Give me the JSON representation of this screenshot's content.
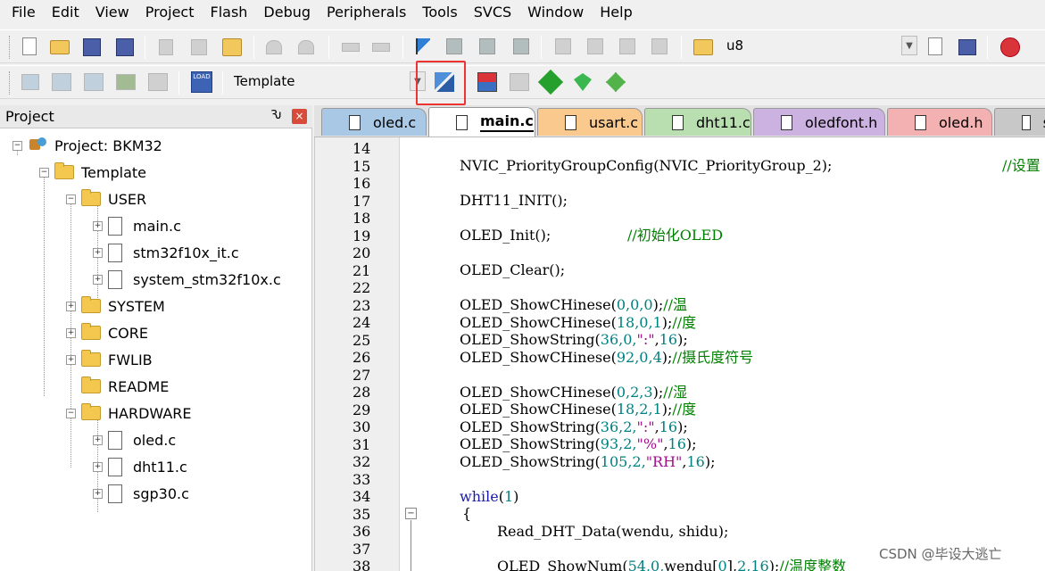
{
  "menu": [
    "File",
    "Edit",
    "View",
    "Project",
    "Flash",
    "Debug",
    "Peripherals",
    "Tools",
    "SVCS",
    "Window",
    "Help"
  ],
  "toolbar1": {
    "target_label": "u8"
  },
  "toolbar2": {
    "target_name": "Template",
    "load_label": "LOAD"
  },
  "project_panel": {
    "title": "Project",
    "pin": "Ԅ",
    "close": "×",
    "tree": {
      "root": "Project: BKM32",
      "target": "Template",
      "groups": {
        "user": "USER",
        "user_files": [
          "main.c",
          "stm32f10x_it.c",
          "system_stm32f10x.c"
        ],
        "system": "SYSTEM",
        "core": "CORE",
        "fwlib": "FWLIB",
        "readme": "README",
        "hardware": "HARDWARE",
        "hardware_files": [
          "oled.c",
          "dht11.c",
          "sgp30.c"
        ]
      }
    }
  },
  "tabs": [
    {
      "label": "oled.c",
      "color": "#a9c8e6",
      "active": false
    },
    {
      "label": "main.c",
      "color": "#ffffff",
      "active": true
    },
    {
      "label": "usart.c",
      "color": "#f9c98e",
      "active": false
    },
    {
      "label": "dht11.c",
      "color": "#b9dfb0",
      "active": false
    },
    {
      "label": "oledfont.h",
      "color": "#ccb2e0",
      "active": false
    },
    {
      "label": "oled.h",
      "color": "#f3b1b1",
      "active": false
    },
    {
      "label": "sta",
      "color": "#c8c8c8",
      "active": false
    }
  ],
  "line_numbers": [
    "14",
    "15",
    "16",
    "17",
    "18",
    "19",
    "20",
    "21",
    "22",
    "23",
    "24",
    "25",
    "26",
    "27",
    "28",
    "29",
    "30",
    "31",
    "32",
    "33",
    "34",
    "35",
    "36",
    "37",
    "38"
  ],
  "code": {
    "l15": "NVIC_PriorityGroupConfig(NVIC_PriorityGroup_2);",
    "l15c": "//设置",
    "l17": "DHT11_INIT();",
    "l19": "OLED_Init();",
    "l19c": "//初始化OLED",
    "l21": "OLED_Clear();",
    "l23a": "OLED_ShowCHinese(",
    "l23n": "0,0,0",
    "l23b": ");",
    "l23c": "//温",
    "l24a": "OLED_ShowCHinese(",
    "l24n": "18,0,1",
    "l24b": ");",
    "l24c": "//度",
    "l25a": "OLED_ShowString(",
    "l25n": "36,0,",
    "l25s": "\":\"",
    "l25m": ",",
    "l25n2": "16",
    "l25b": ");",
    "l26a": "OLED_ShowCHinese(",
    "l26n": "92,0,4",
    "l26b": ");",
    "l26c": "//摄氏度符号",
    "l28a": "OLED_ShowCHinese(",
    "l28n": "0,2,3",
    "l28b": ");",
    "l28c": "//湿",
    "l29a": "OLED_ShowCHinese(",
    "l29n": "18,2,1",
    "l29b": ");",
    "l29c": "//度",
    "l30a": "OLED_ShowString(",
    "l30n": "36,2,",
    "l30s": "\":\"",
    "l30m": ",",
    "l30n2": "16",
    "l30b": ");",
    "l31a": "OLED_ShowString(",
    "l31n": "93,2,",
    "l31s": "\"%\"",
    "l31m": ",",
    "l31n2": "16",
    "l31b": ");",
    "l32a": "OLED_ShowString(",
    "l32n": "105,2,",
    "l32s": "\"RH\"",
    "l32m": ",",
    "l32n2": "16",
    "l32b": ");",
    "l34k": "while",
    "l34a": "(",
    "l34n": "1",
    "l34b": ")",
    "l35": "{",
    "l36": "Read_DHT_Data(wendu, shidu);",
    "l38a": "OLED_ShowNum(",
    "l38n": "54,0,",
    "l38m": "wendu[",
    "l38n2": "0",
    "l38m2": "],",
    "l38n3": "2,16",
    "l38b": ");",
    "l38c": "//温度整数"
  },
  "watermark": "CSDN @毕设大逃亡"
}
